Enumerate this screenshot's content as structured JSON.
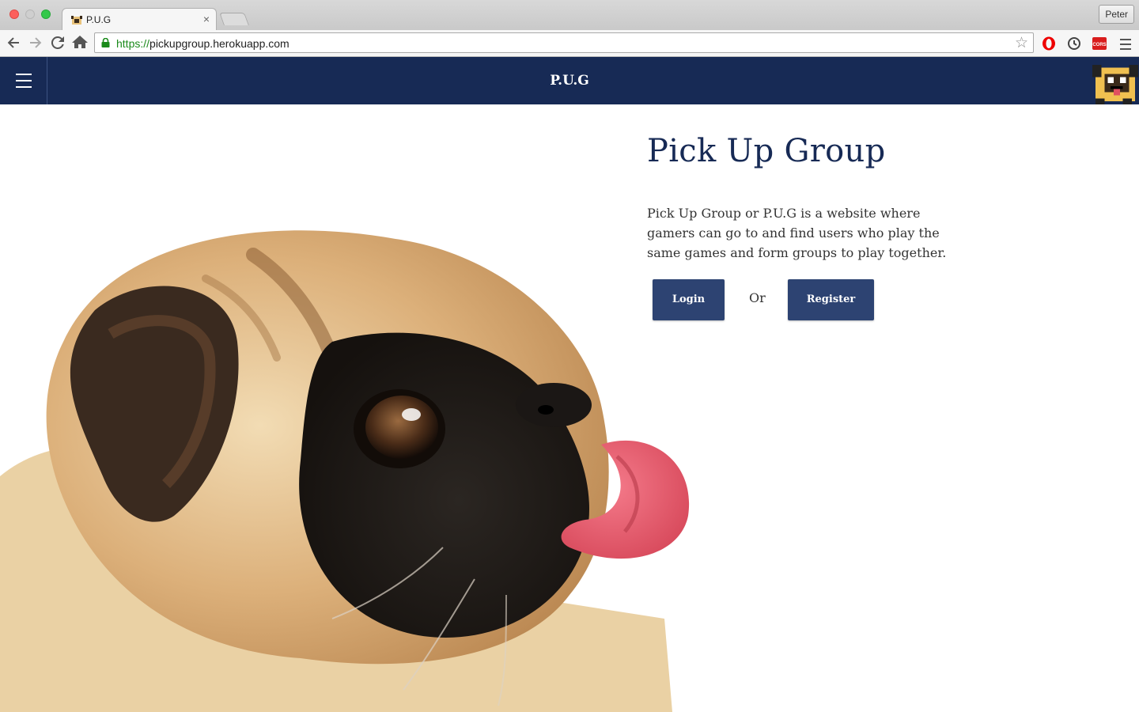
{
  "browser": {
    "tab_title": "P.U.G",
    "tab_close": "×",
    "profile_name": "Peter",
    "url_scheme": "https://",
    "url_host": "pickupgroup.herokuapp.com",
    "extensions": [
      "opera-icon",
      "sync-icon",
      "cors-icon"
    ],
    "cors_label": "CORS"
  },
  "site": {
    "brand": "P.U.G",
    "nav_bg": "#172a55",
    "button_bg": "#2d4372"
  },
  "main": {
    "heading": "Pick Up Group",
    "description": "Pick Up Group or P.U.G is a website where gamers can go to and find users who play the same games and form groups to play together.",
    "login_label": "Login",
    "or_label": "Or",
    "register_label": "Register"
  }
}
